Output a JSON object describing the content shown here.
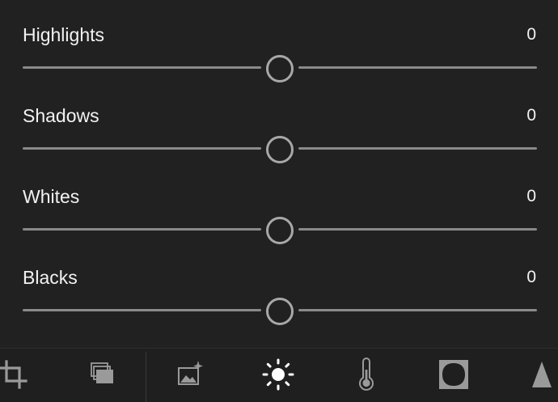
{
  "sliders": [
    {
      "label": "Highlights",
      "value": "0",
      "position": 0.5
    },
    {
      "label": "Shadows",
      "value": "0",
      "position": 0.5
    },
    {
      "label": "Whites",
      "value": "0",
      "position": 0.5
    },
    {
      "label": "Blacks",
      "value": "0",
      "position": 0.5
    }
  ],
  "toolbar": {
    "tools": [
      {
        "icon": "crop-icon",
        "active": false
      },
      {
        "icon": "presets-icon",
        "active": false
      },
      {
        "icon": "auto-enhance-icon",
        "active": false
      },
      {
        "icon": "light-icon",
        "active": true
      },
      {
        "icon": "color-temperature-icon",
        "active": false
      },
      {
        "icon": "vignette-icon",
        "active": false
      },
      {
        "icon": "detail-icon",
        "active": false
      }
    ]
  },
  "colors": {
    "background": "#212121",
    "text": "#f2f2f2",
    "track": "#8a8a8a",
    "thumb": "#a8a8a8",
    "icon": "#9a9a9a",
    "active_icon": "#ffffff"
  }
}
